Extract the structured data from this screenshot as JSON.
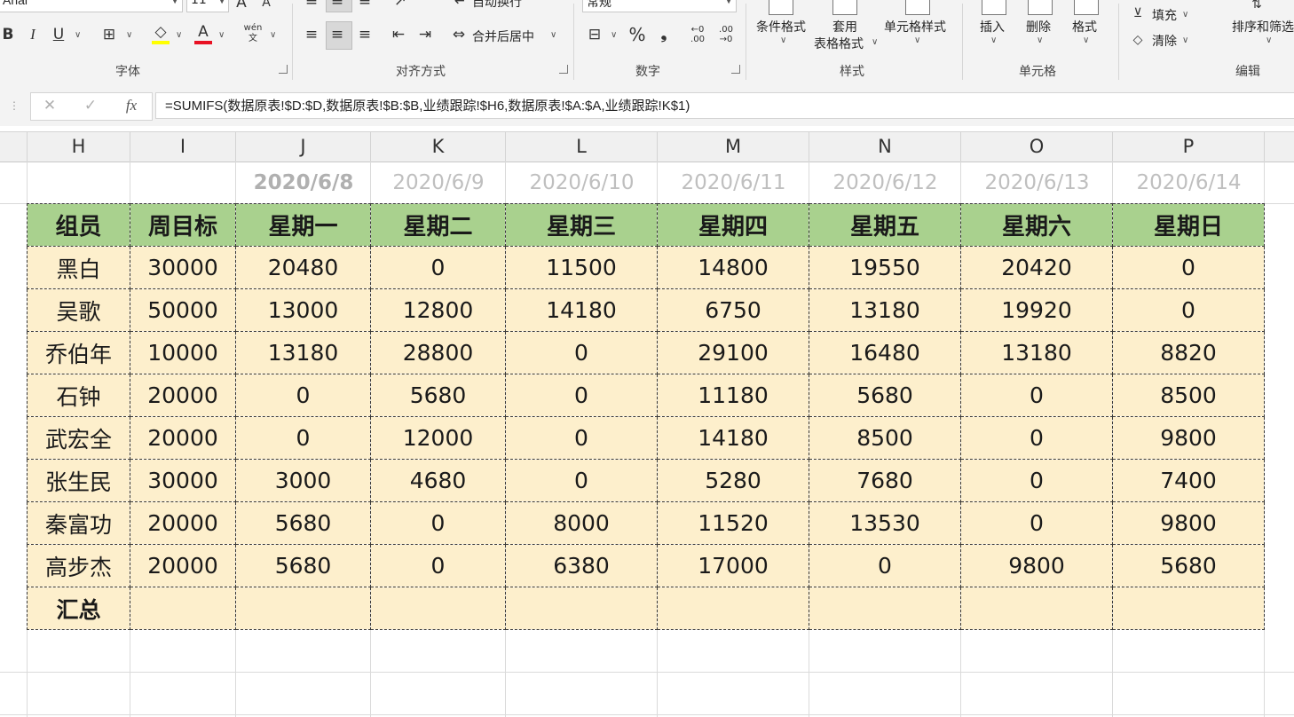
{
  "ribbon": {
    "font": {
      "name": "Arial",
      "size": "11",
      "label": "字体"
    },
    "align": {
      "label": "对齐方式",
      "wrap_label": "自动换行",
      "merge_label": "合并后居中"
    },
    "number": {
      "label": "数字",
      "format": "常规"
    },
    "styles": {
      "label": "样式",
      "conditional": "条件格式",
      "table_format_line1": "套用",
      "table_format_line2": "表格格式",
      "cell_styles": "单元格样式"
    },
    "cells": {
      "label": "单元格",
      "insert": "插入",
      "delete": "删除",
      "format": "格式"
    },
    "editing": {
      "label": "编辑",
      "fill": "填充",
      "clear": "清除",
      "sort_filter": "排序和筛选"
    },
    "font_color": "#e81123",
    "highlight_color": "#ffff00"
  },
  "formula_bar": {
    "formula": "=SUMIFS(数据原表!$D:$D,数据原表!$B:$B,业绩跟踪!$H6,数据原表!$A:$A,业绩跟踪!K$1)"
  },
  "columns": [
    "H",
    "I",
    "J",
    "K",
    "L",
    "M",
    "N",
    "O",
    "P"
  ],
  "dates": [
    "2020/6/8",
    "2020/6/9",
    "2020/6/10",
    "2020/6/11",
    "2020/6/12",
    "2020/6/13",
    "2020/6/14"
  ],
  "table": {
    "header": [
      "组员",
      "周目标",
      "星期一",
      "星期二",
      "星期三",
      "星期四",
      "星期五",
      "星期六",
      "星期日"
    ],
    "rows": [
      [
        "黑白",
        "30000",
        "20480",
        "0",
        "11500",
        "14800",
        "19550",
        "20420",
        "0"
      ],
      [
        "吴歌",
        "50000",
        "13000",
        "12800",
        "14180",
        "6750",
        "13180",
        "19920",
        "0"
      ],
      [
        "乔伯年",
        "10000",
        "13180",
        "28800",
        "0",
        "29100",
        "16480",
        "13180",
        "8820"
      ],
      [
        "石钟",
        "20000",
        "0",
        "5680",
        "0",
        "11180",
        "5680",
        "0",
        "8500"
      ],
      [
        "武宏全",
        "20000",
        "0",
        "12000",
        "0",
        "14180",
        "8500",
        "0",
        "9800"
      ],
      [
        "张生民",
        "30000",
        "3000",
        "4680",
        "0",
        "5280",
        "7680",
        "0",
        "7400"
      ],
      [
        "秦富功",
        "20000",
        "5680",
        "0",
        "8000",
        "11520",
        "13530",
        "0",
        "9800"
      ],
      [
        "高步杰",
        "20000",
        "5680",
        "0",
        "6380",
        "17000",
        "0",
        "9800",
        "5680"
      ]
    ],
    "total_label": "汇总",
    "header_color": "#a9d18e",
    "body_color": "#fdefcc"
  }
}
